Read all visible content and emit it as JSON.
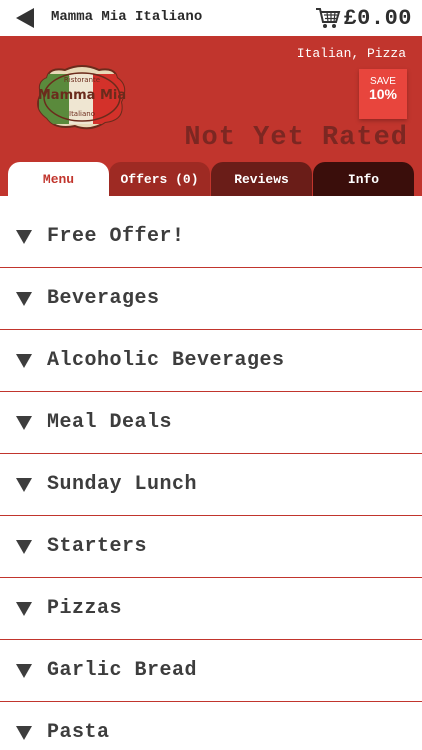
{
  "header": {
    "title": "Mamma Mia Italiano",
    "cart_total": "£0.00",
    "back_icon": "back-arrow-icon",
    "cart_icon": "shopping-cart-icon"
  },
  "restaurant": {
    "cuisine": "Italian, Pizza",
    "logo_text_top": "Ristorante",
    "logo_text_main": "Mamma Mia",
    "logo_text_bottom": "Italiano",
    "save_label": "SAVE",
    "save_percent": "10%",
    "rating": "Not Yet Rated"
  },
  "tabs": [
    {
      "label": "Menu",
      "active": true
    },
    {
      "label": "Offers (0)",
      "active": false
    },
    {
      "label": "Reviews",
      "active": false
    },
    {
      "label": "Info",
      "active": false
    }
  ],
  "menu": {
    "categories": [
      "Free Offer!",
      "Beverages",
      "Alcoholic Beverages",
      "Meal Deals",
      "Sunday Lunch",
      "Starters",
      "Pizzas",
      "Garlic Bread",
      "Pasta"
    ]
  },
  "colors": {
    "brand_red": "#c1352d",
    "text_dark": "#3d3d3d"
  }
}
